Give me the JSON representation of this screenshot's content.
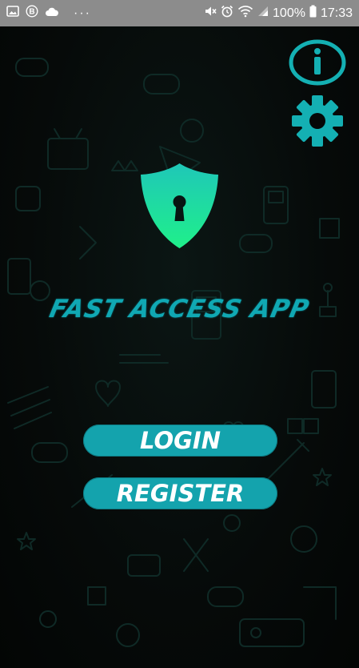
{
  "status_bar": {
    "battery_percent": "100%",
    "time": "17:33",
    "left_icons": [
      "image-icon",
      "b-badge-icon",
      "cloud-icon"
    ],
    "overflow": "···",
    "right_icons": [
      "mute-icon",
      "alarm-icon",
      "wifi-icon",
      "signal-icon",
      "battery-icon"
    ]
  },
  "header_actions": {
    "info_icon": "info-icon",
    "settings_icon": "gear-icon"
  },
  "logo": {
    "icon": "shield-lock-icon",
    "gradient_top": "#1fc7b8",
    "gradient_bottom": "#1ff08a"
  },
  "app_title": "FAST ACCESS APP",
  "buttons": {
    "login_label": "LOGIN",
    "register_label": "REGISTER"
  },
  "colors": {
    "accent": "#14a3ad",
    "background": "#050807",
    "doodle": "#0f2a26",
    "status_bar": "#8c8c8c"
  }
}
